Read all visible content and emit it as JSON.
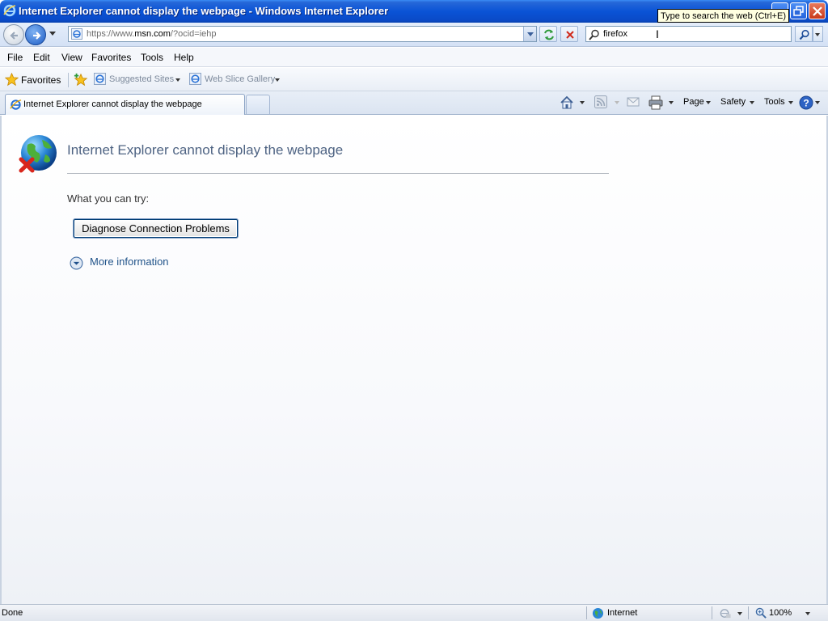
{
  "window": {
    "title": "Internet Explorer cannot display the webpage - Windows Internet Explorer",
    "tooltip": "Type to search the web (Ctrl+E)"
  },
  "navigation": {
    "address_scheme": "https://www.",
    "address_host": "msn.com",
    "address_rest": "/?ocid=iehp",
    "search_query": "firefox"
  },
  "menu": {
    "items": [
      "File",
      "Edit",
      "View",
      "Favorites",
      "Tools",
      "Help"
    ]
  },
  "favorites_bar": {
    "favorites_label": "Favorites",
    "links": [
      "Suggested Sites",
      "Web Slice Gallery"
    ]
  },
  "tabs": {
    "active_tab_title": "Internet Explorer cannot display the webpage"
  },
  "command_bar": {
    "page": "Page",
    "safety": "Safety",
    "tools": "Tools"
  },
  "content": {
    "heading": "Internet Explorer cannot display the webpage",
    "what_you_can_try": "What you can try:",
    "diagnose_button": "Diagnose Connection Problems",
    "more_information": "More information"
  },
  "status": {
    "left": "Done",
    "zone": "Internet",
    "zoom": "100%"
  },
  "colors": {
    "titlebar": "#0a53d6",
    "heading_text": "#4e6383",
    "link_text": "#1f5289"
  }
}
